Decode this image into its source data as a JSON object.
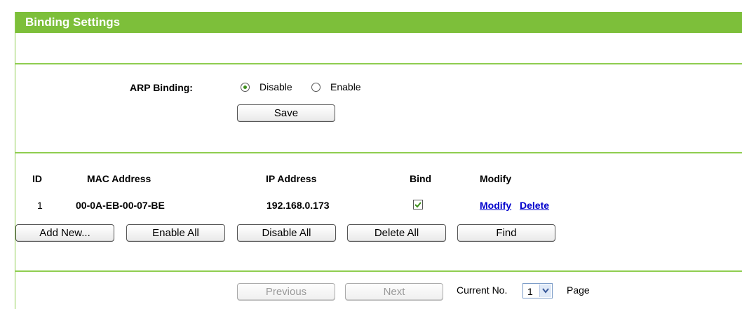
{
  "header": {
    "title": "Binding Settings"
  },
  "arp": {
    "label": "ARP Binding:",
    "options": [
      {
        "label": "Disable",
        "selected": true
      },
      {
        "label": "Enable",
        "selected": false
      }
    ],
    "save_label": "Save"
  },
  "table": {
    "columns": [
      "ID",
      "MAC Address",
      "IP Address",
      "Bind",
      "Modify"
    ],
    "rows": [
      {
        "id": "1",
        "mac": "00-0A-EB-00-07-BE",
        "ip": "192.168.0.173",
        "bind": true,
        "modify": "Modify",
        "delete": "Delete"
      }
    ]
  },
  "actions": {
    "add_new": "Add New...",
    "enable_all": "Enable All",
    "disable_all": "Disable All",
    "delete_all": "Delete All",
    "find": "Find"
  },
  "pagination": {
    "previous": "Previous",
    "next": "Next",
    "current_label": "Current No.",
    "current_value": "1",
    "page_label": "Page"
  },
  "colors": {
    "header_bg": "#7dbf3a",
    "rule": "#8fcd50",
    "link": "#0000cc",
    "radio_dot": "#3c8e1a"
  }
}
